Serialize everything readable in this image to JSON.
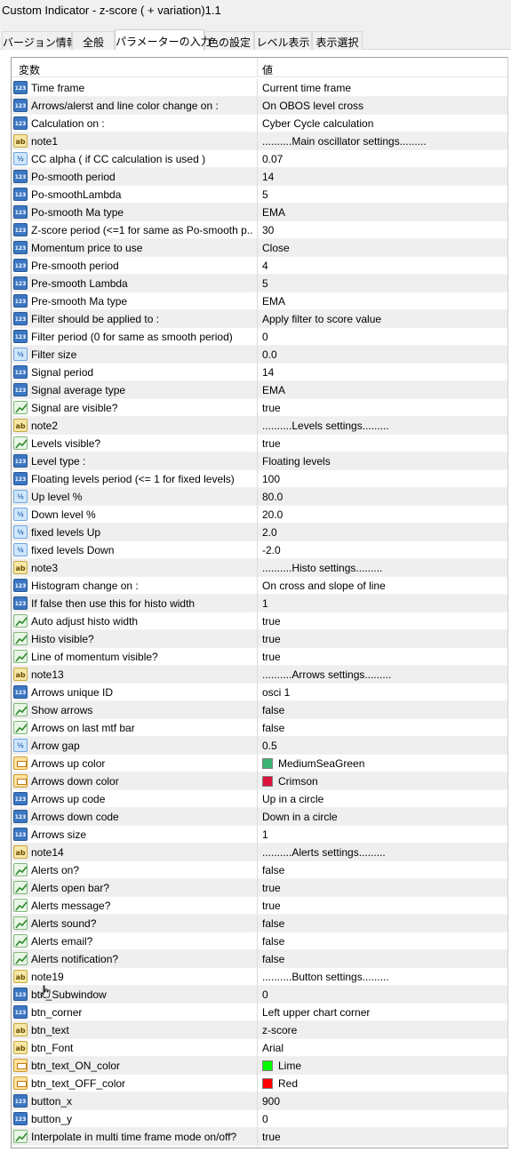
{
  "window": {
    "title": "Custom Indicator - z-score ( + variation)1.1"
  },
  "tabs": [
    {
      "label": "バージョン情報"
    },
    {
      "label": "全般"
    },
    {
      "label": "パラメーターの入力",
      "active": true
    },
    {
      "label": "色の設定"
    },
    {
      "label": "レベル表示"
    },
    {
      "label": "表示選択"
    }
  ],
  "grid": {
    "header": {
      "name": "変数",
      "value": "値"
    },
    "rows": [
      {
        "type": "int",
        "name": "Time frame",
        "value": "Current time frame"
      },
      {
        "type": "int",
        "name": "Arrows/alerst and line color change on :",
        "value": "On OBOS level cross"
      },
      {
        "type": "int",
        "name": "Calculation on :",
        "value": "Cyber Cycle calculation"
      },
      {
        "type": "str",
        "name": "note1",
        "value": "..........Main oscillator settings........."
      },
      {
        "type": "dbl",
        "name": "CC alpha ( if CC calculation is used )",
        "value": "0.07"
      },
      {
        "type": "int",
        "name": "Po-smooth period",
        "value": "14"
      },
      {
        "type": "int",
        "name": "Po-smoothLambda",
        "value": "5"
      },
      {
        "type": "int",
        "name": "Po-smooth Ma type",
        "value": "EMA"
      },
      {
        "type": "int",
        "name": "Z-score period (<=1 for same as Po-smooth p...",
        "value": "30"
      },
      {
        "type": "int",
        "name": "Momentum  price to use",
        "value": "Close"
      },
      {
        "type": "int",
        "name": "Pre-smooth period",
        "value": "4"
      },
      {
        "type": "int",
        "name": "Pre-smooth  Lambda",
        "value": "5"
      },
      {
        "type": "int",
        "name": "Pre-smooth Ma type",
        "value": "EMA"
      },
      {
        "type": "int",
        "name": "Filter should be applied to :",
        "value": "Apply filter to score value"
      },
      {
        "type": "int",
        "name": "Filter period (0 for same as smooth period)",
        "value": "0"
      },
      {
        "type": "dbl",
        "name": "Filter size",
        "value": "0.0"
      },
      {
        "type": "int",
        "name": "Signal period",
        "value": "14"
      },
      {
        "type": "int",
        "name": "Signal average type",
        "value": "EMA"
      },
      {
        "type": "bool",
        "name": "Signal are visible?",
        "value": "true"
      },
      {
        "type": "str",
        "name": "note2",
        "value": "..........Levels settings........."
      },
      {
        "type": "bool",
        "name": "Levels visible?",
        "value": "true"
      },
      {
        "type": "int",
        "name": "Level type :",
        "value": "Floating levels"
      },
      {
        "type": "int",
        "name": "Floating levels period (<= 1 for fixed levels)",
        "value": "100"
      },
      {
        "type": "dbl",
        "name": "Up level %",
        "value": "80.0"
      },
      {
        "type": "dbl",
        "name": "Down level %",
        "value": "20.0"
      },
      {
        "type": "dbl",
        "name": "fixed levels Up",
        "value": "2.0"
      },
      {
        "type": "dbl",
        "name": "fixed levels Down",
        "value": "-2.0"
      },
      {
        "type": "str",
        "name": "note3",
        "value": "..........Histo settings........."
      },
      {
        "type": "int",
        "name": "Histogram change on :",
        "value": "On cross and slope of line"
      },
      {
        "type": "int",
        "name": "If  false then use this for histo width",
        "value": "1"
      },
      {
        "type": "bool",
        "name": "Auto adjust histo width",
        "value": "true"
      },
      {
        "type": "bool",
        "name": "Histo visible?",
        "value": "true"
      },
      {
        "type": "bool",
        "name": "Line of momentum visible?",
        "value": "true"
      },
      {
        "type": "str",
        "name": "note13",
        "value": "..........Arrows settings........."
      },
      {
        "type": "int",
        "name": "Arrows unique ID",
        "value": "osci 1"
      },
      {
        "type": "bool",
        "name": "Show arrows",
        "value": "false"
      },
      {
        "type": "bool",
        "name": "Arrows on last mtf bar",
        "value": "false"
      },
      {
        "type": "dbl",
        "name": "Arrow gap",
        "value": "0.5"
      },
      {
        "type": "col",
        "name": "Arrows up color",
        "value": "MediumSeaGreen",
        "swatch": "#3cb371"
      },
      {
        "type": "col",
        "name": "Arrows down color",
        "value": "Crimson",
        "swatch": "#dc143c"
      },
      {
        "type": "int",
        "name": "Arrows up code",
        "value": "Up in a circle"
      },
      {
        "type": "int",
        "name": "Arrows down code",
        "value": "Down in a circle"
      },
      {
        "type": "int",
        "name": "Arrows  size",
        "value": "1"
      },
      {
        "type": "str",
        "name": "note14",
        "value": "..........Alerts settings........."
      },
      {
        "type": "bool",
        "name": "Alerts on?",
        "value": "false"
      },
      {
        "type": "bool",
        "name": "Alerts open bar?",
        "value": "true"
      },
      {
        "type": "bool",
        "name": "Alerts message?",
        "value": "true"
      },
      {
        "type": "bool",
        "name": "Alerts sound?",
        "value": "false"
      },
      {
        "type": "bool",
        "name": "Alerts email?",
        "value": "false"
      },
      {
        "type": "bool",
        "name": "Alerts notification?",
        "value": "false"
      },
      {
        "type": "str",
        "name": "note19",
        "value": "..........Button  settings........."
      },
      {
        "type": "int",
        "name": "btn_Subwindow",
        "value": "0"
      },
      {
        "type": "int",
        "name": "btn_corner",
        "value": "Left upper chart corner"
      },
      {
        "type": "str",
        "name": "btn_text",
        "value": "z-score"
      },
      {
        "type": "str",
        "name": "btn_Font",
        "value": "Arial"
      },
      {
        "type": "col",
        "name": "btn_text_ON_color",
        "value": "Lime",
        "swatch": "#00ff00"
      },
      {
        "type": "col",
        "name": "btn_text_OFF_color",
        "value": "Red",
        "swatch": "#ff0000"
      },
      {
        "type": "int",
        "name": "button_x",
        "value": "900"
      },
      {
        "type": "int",
        "name": "button_y",
        "value": "0"
      },
      {
        "type": "bool",
        "name": "Interpolate in multi time frame mode on/off?",
        "value": "true"
      }
    ]
  }
}
